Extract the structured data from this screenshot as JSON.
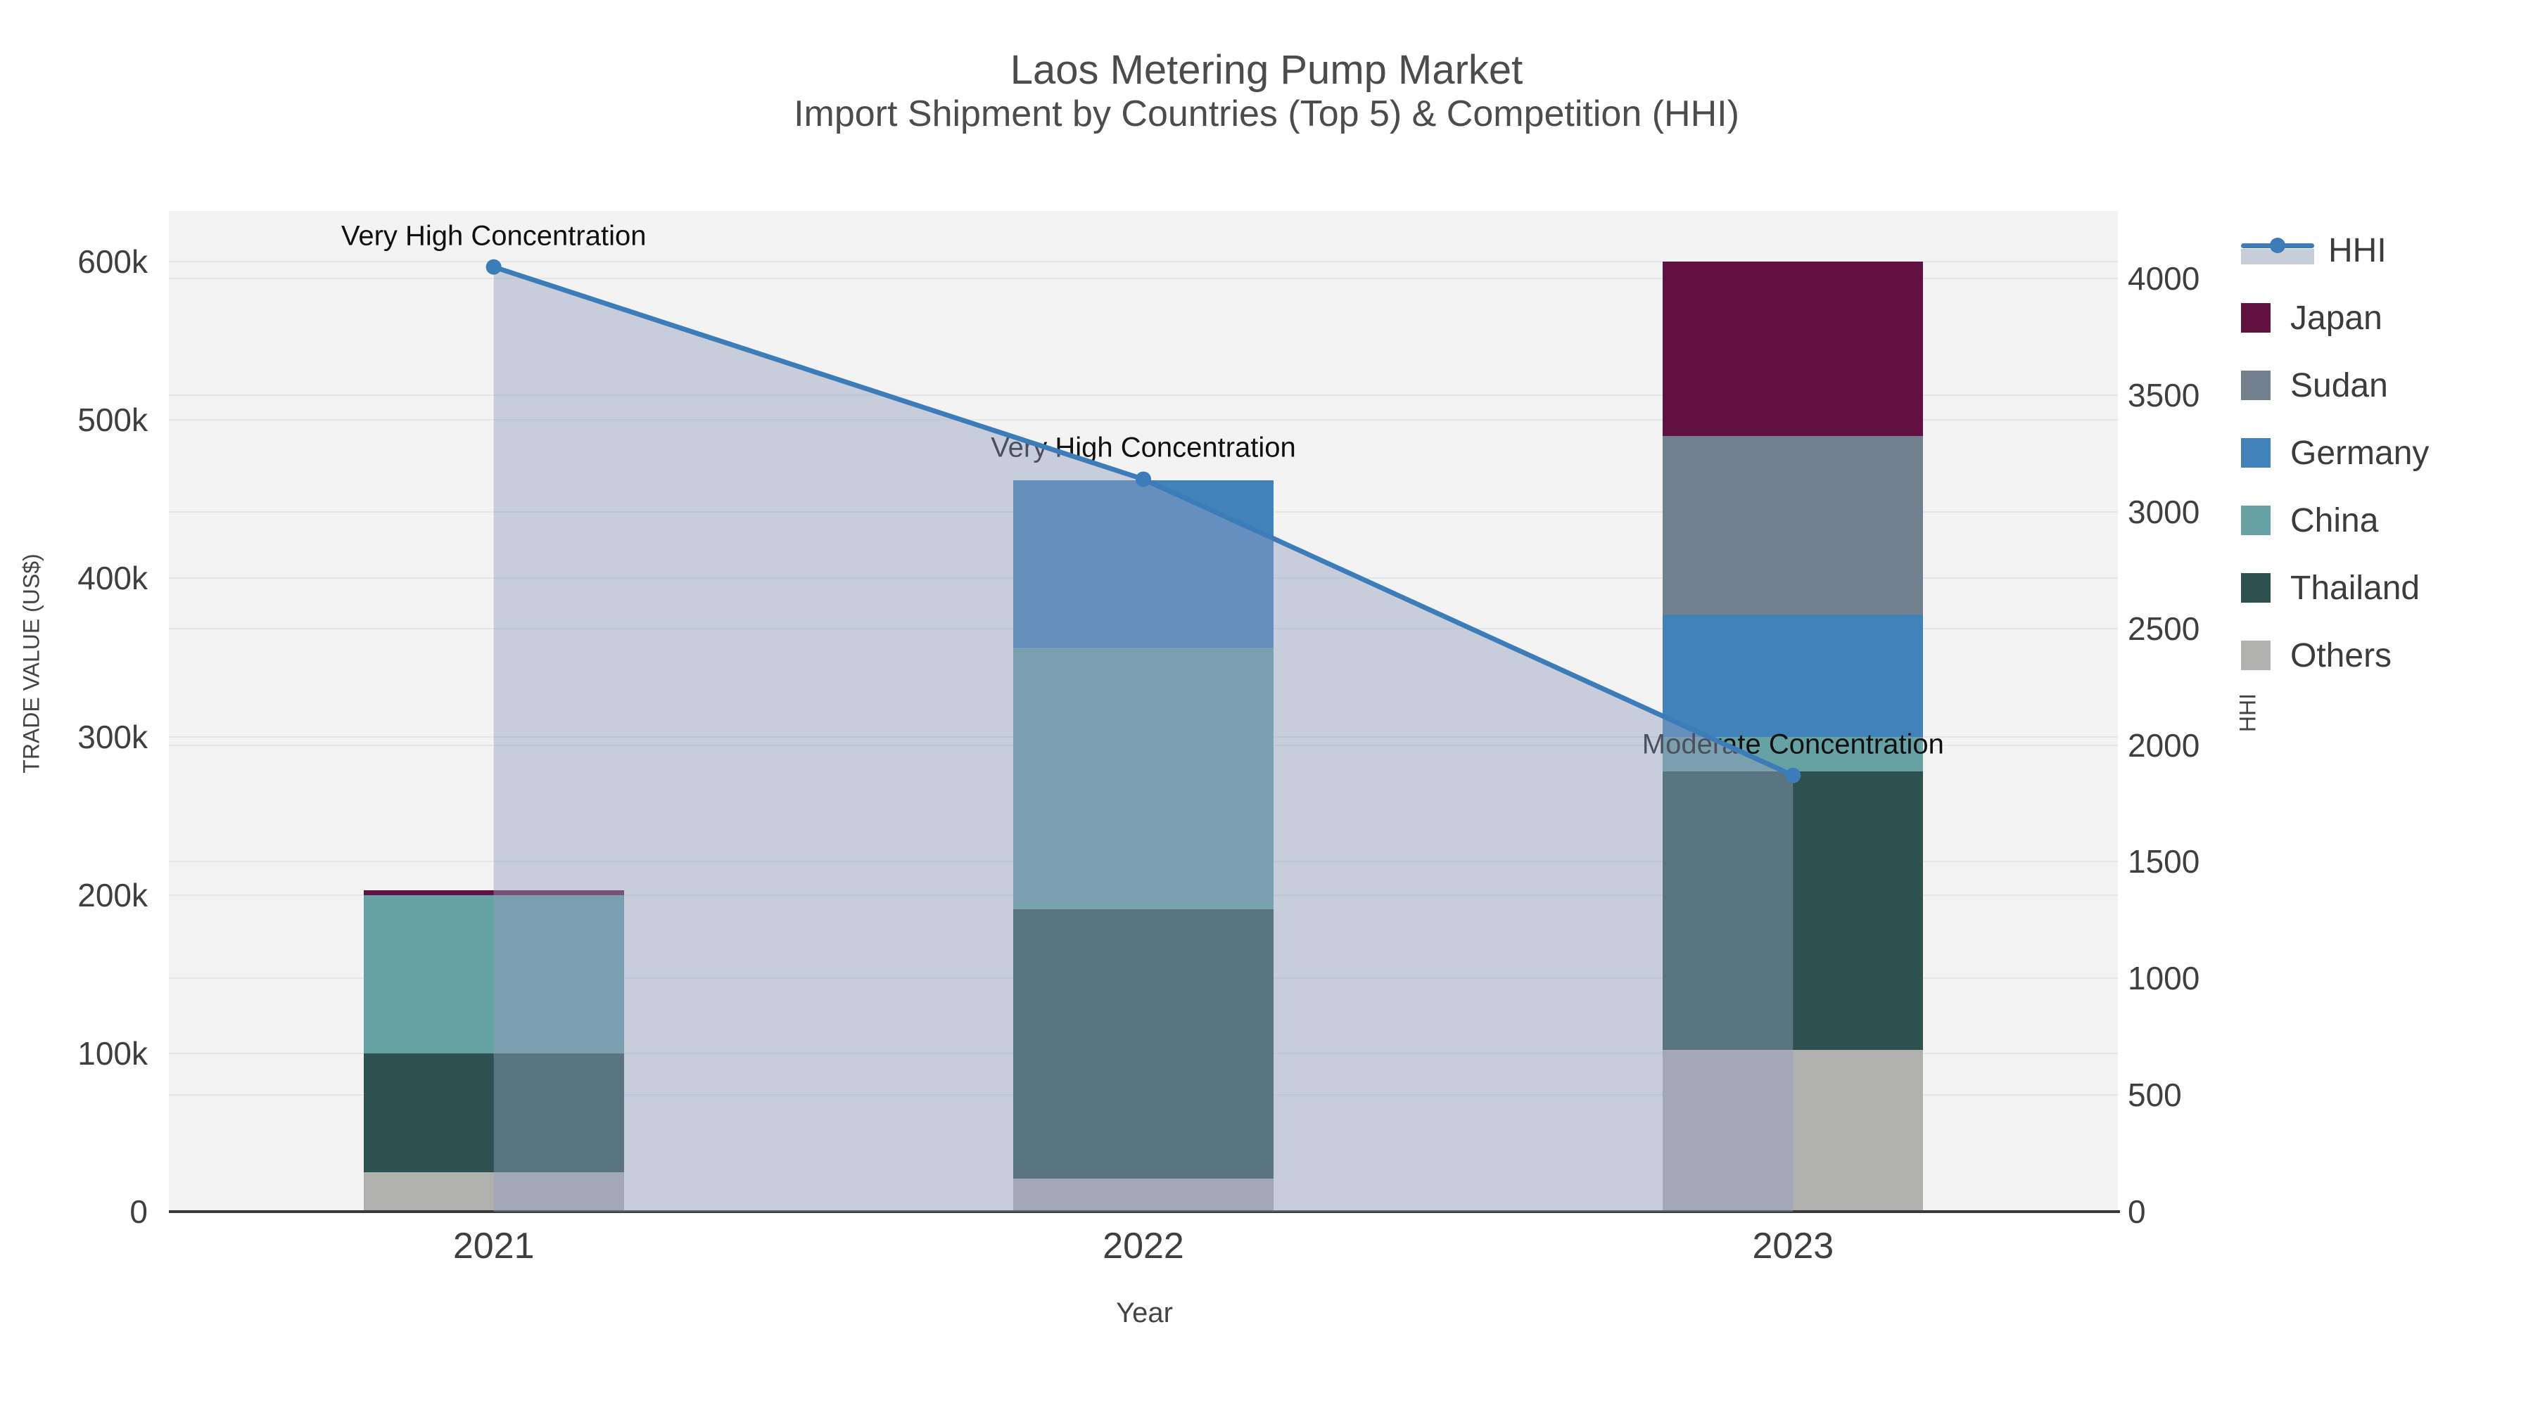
{
  "chart_data": {
    "type": "bar",
    "subtype": "stacked-bar-with-line-overlay",
    "title": "Laos Metering Pump Market",
    "subtitle": "Import Shipment by Countries (Top 5) & Competition (HHI)",
    "xlabel": "Year",
    "ylabel_left": "TRADE VALUE (US$)",
    "ylabel_right": "HHI",
    "categories": [
      "2021",
      "2022",
      "2023"
    ],
    "stack_order": [
      "Others",
      "Thailand",
      "China",
      "Germany",
      "Sudan",
      "Japan"
    ],
    "series": [
      {
        "name": "Japan",
        "color": "#621240",
        "values": [
          3000,
          0,
          110000
        ]
      },
      {
        "name": "Sudan",
        "color": "#73808E",
        "values": [
          0,
          0,
          113000
        ]
      },
      {
        "name": "Germany",
        "color": "#4182BB",
        "values": [
          0,
          106000,
          77000
        ]
      },
      {
        "name": "China",
        "color": "#66A1A3",
        "values": [
          100000,
          165000,
          22000
        ]
      },
      {
        "name": "Thailand",
        "color": "#2C514E",
        "values": [
          75000,
          170000,
          176000
        ]
      },
      {
        "name": "Others",
        "color": "#B0B0AE",
        "values": [
          25000,
          21000,
          102000
        ]
      }
    ],
    "line_series": {
      "name": "HHI",
      "color": "#3C7CB8",
      "area_fill": "rgba(147,160,190,0.45)",
      "values": [
        4050,
        3140,
        1870
      ]
    },
    "annotations": [
      {
        "category": "2021",
        "text": "Very High Concentration"
      },
      {
        "category": "2022",
        "text": "Very High Concentration"
      },
      {
        "category": "2023",
        "text": "Moderate Concentration"
      }
    ],
    "axis_left": {
      "tick_values": [
        0,
        100000,
        200000,
        300000,
        400000,
        500000,
        600000
      ],
      "tick_labels": [
        "0",
        "100k",
        "200k",
        "300k",
        "400k",
        "500k",
        "600k"
      ],
      "range": [
        0,
        632000
      ],
      "grid": true
    },
    "axis_right": {
      "tick_values": [
        0,
        500,
        1000,
        1500,
        2000,
        2500,
        3000,
        3500,
        4000
      ],
      "tick_labels": [
        "0",
        "500",
        "1000",
        "1500",
        "2000",
        "2500",
        "3000",
        "3500",
        "4000"
      ],
      "range": [
        0,
        4290
      ],
      "grid": true
    },
    "legend_position": "right"
  },
  "legend": {
    "items": [
      {
        "label": "HHI",
        "type": "line-area"
      },
      {
        "label": "Japan",
        "type": "box",
        "color": "#621240"
      },
      {
        "label": "Sudan",
        "type": "box",
        "color": "#73808E"
      },
      {
        "label": "Germany",
        "type": "box",
        "color": "#4182BB"
      },
      {
        "label": "China",
        "type": "box",
        "color": "#66A1A3"
      },
      {
        "label": "Thailand",
        "type": "box",
        "color": "#2C514E"
      },
      {
        "label": "Others",
        "type": "box",
        "color": "#B0B0AE"
      }
    ]
  },
  "colors": {
    "plot_background": "#F2F3F2",
    "gridline": "#E4E6E9",
    "axis_line": "#3A3A3A",
    "hhi_line": "#3C7CB8",
    "hhi_area": "rgba(147,160,190,0.45)",
    "title_text": "#4C4C4C",
    "tick_text": "#3F3F3F",
    "annotation_text": "#111111"
  }
}
